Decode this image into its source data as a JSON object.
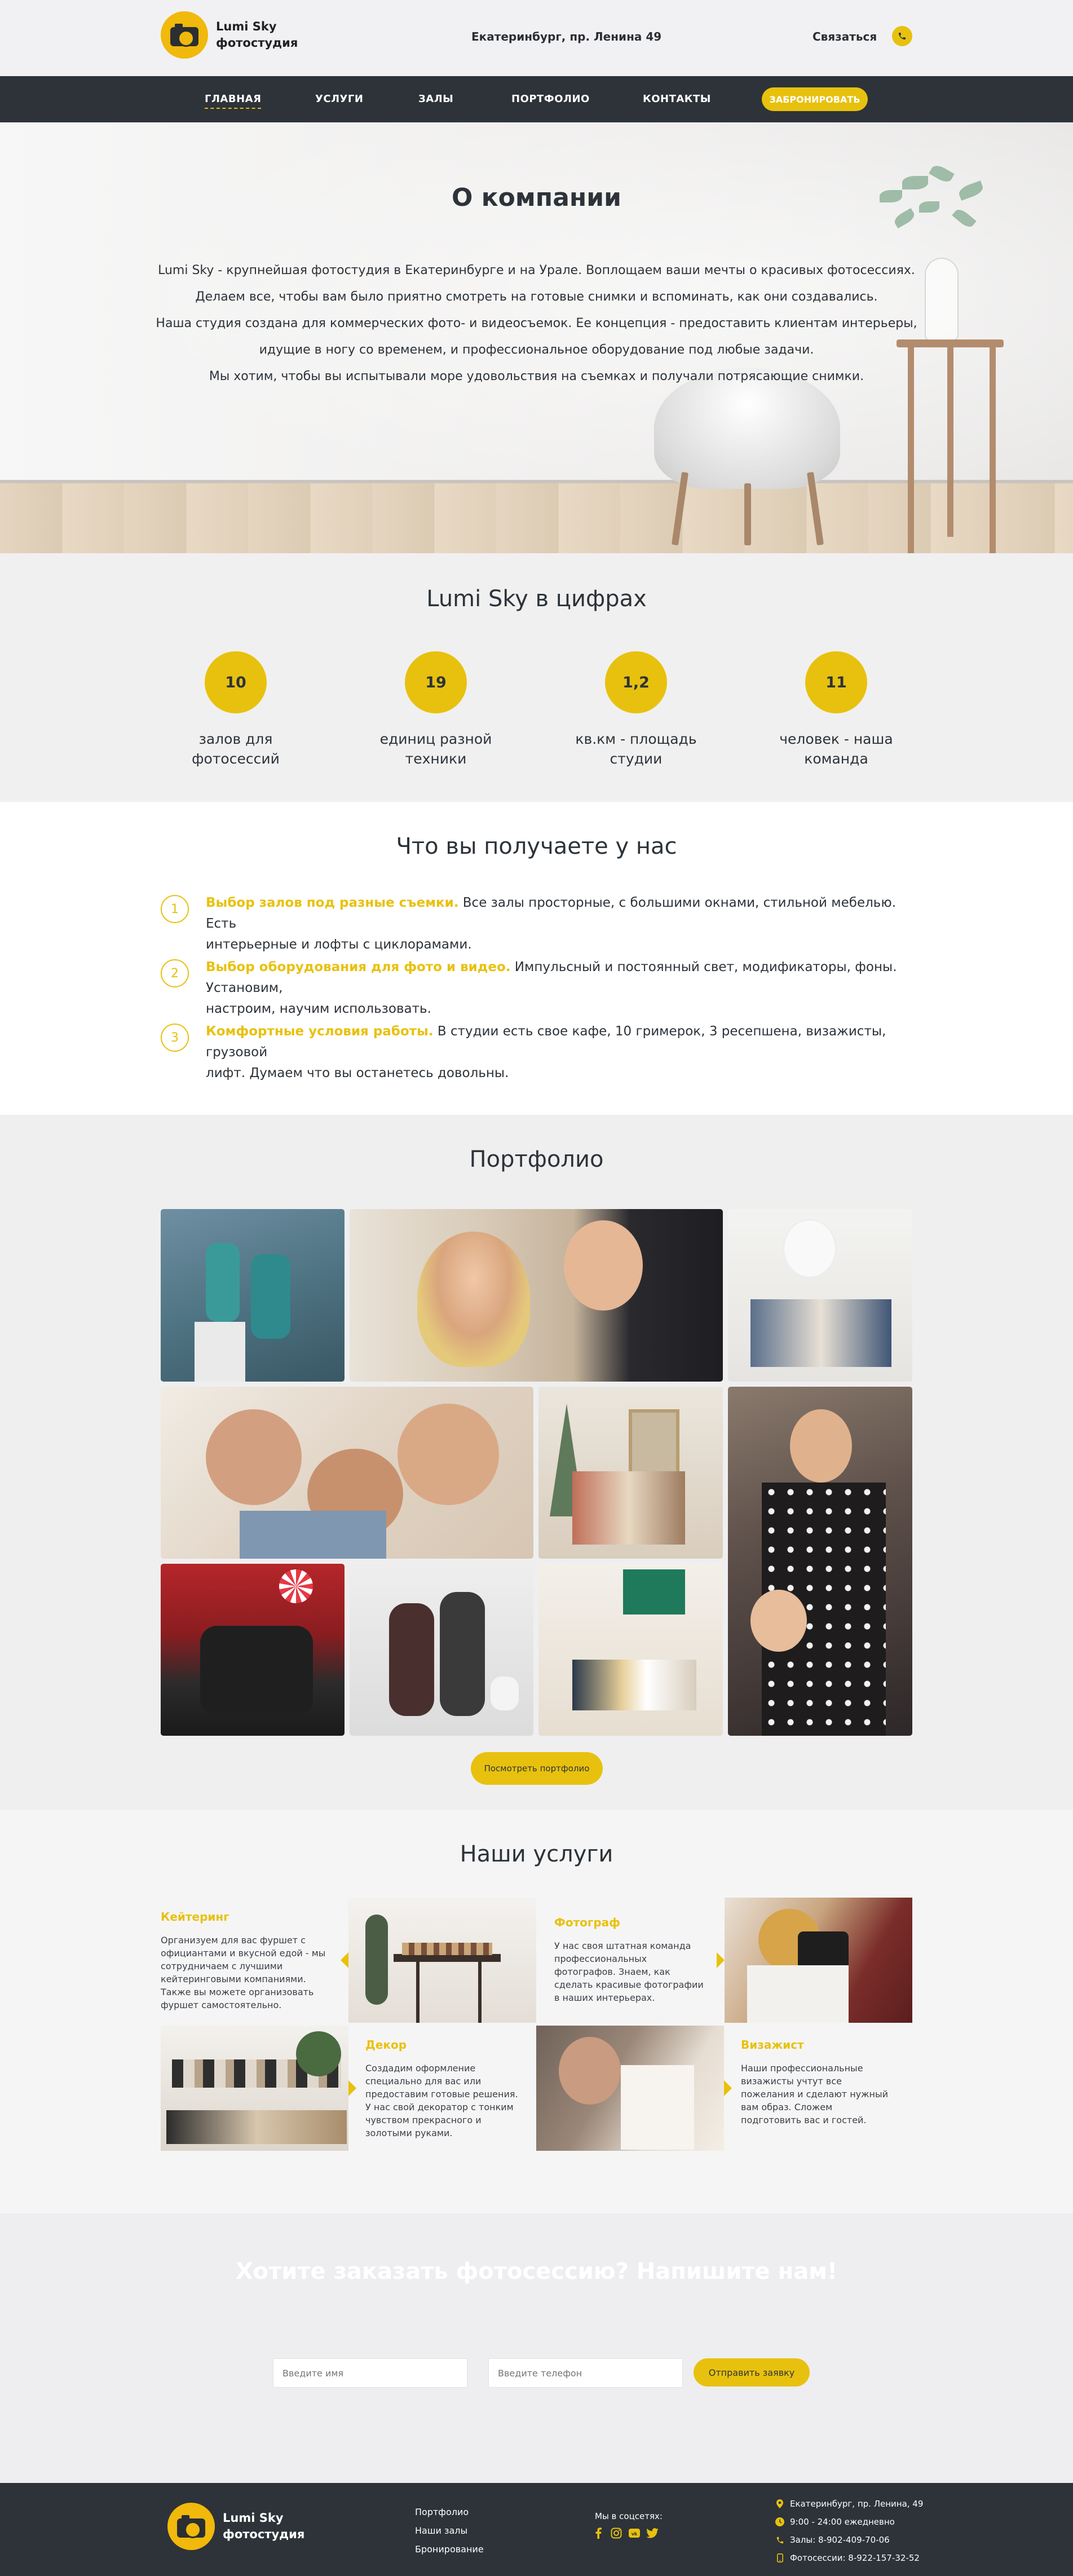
{
  "header": {
    "logo_line1": "Lumi Sky",
    "logo_line2": "фотостудия",
    "address": "Екатеринбург, пр. Ленина 49",
    "contact_label": "Связаться",
    "icons": {
      "phone": "phone-icon"
    }
  },
  "nav": {
    "items": [
      {
        "label": "Главная",
        "active": true
      },
      {
        "label": "Услуги"
      },
      {
        "label": "Залы"
      },
      {
        "label": "Портфолио"
      },
      {
        "label": "Контакты"
      }
    ],
    "book_label": "Забронировать"
  },
  "hero": {
    "title": "О компании",
    "lines": [
      "Lumi Sky - крупнейшая фотостудия в Екатеринбурге и на Урале. Воплощаем ваши мечты о красивых фотосессиях.",
      "Делаем все, чтобы вам было приятно смотреть на готовые снимки и вспоминать, как они создавались.",
      "Наша студия создана для коммерческих фото- и видеосъемок. Ее концепция - предоставить клиентам интерьеры,",
      "идущие в ногу со временем, и профессиональное оборудование под любые задачи.",
      "Мы хотим, чтобы вы испытывали море удовольствия на съемках и получали потрясающие снимки."
    ]
  },
  "numbers": {
    "title": "Lumi Sky в цифрах",
    "stats": [
      {
        "value": "10",
        "label_1": "залов для",
        "label_2": "фотосессий"
      },
      {
        "value": "19",
        "label_1": "единиц разной",
        "label_2": "техники"
      },
      {
        "value": "1,2",
        "label_1": "кв.км - площадь",
        "label_2": "студии"
      },
      {
        "value": "11",
        "label_1": "человек - наша",
        "label_2": "команда"
      }
    ]
  },
  "benefits": {
    "title": "Что вы получаете у нас",
    "items": [
      {
        "num": "1",
        "highlight": "Выбор залов под разные съемки.",
        "line1_rest": " Все залы просторные, с большими окнами, стильной мебелью. Есть",
        "line2": "интерьерные и лофты с циклорамами."
      },
      {
        "num": "2",
        "highlight": "Выбор оборудования для фото и видео.",
        "line1_rest": " Импульсный и постоянный свет, модификаторы, фоны. Установим,",
        "line2": "настроим, научим использовать."
      },
      {
        "num": "3",
        "highlight": "Комфортные условия работы.",
        "line1_rest": " В студии есть свое кафе, 10 гримерок, 3 ресепшена, визажисты, грузовой",
        "line2": "лифт. Думаем что вы останетесь довольны."
      }
    ]
  },
  "portfolio": {
    "title": "Портфолио",
    "button_label": "Посмотреть портфолио"
  },
  "services": {
    "title": "Наши услуги",
    "items": [
      {
        "title": "Кейтеринг",
        "desc": [
          "Организуем для вас фуршет с",
          "официантами и вкусной едой - мы",
          "сотрудничаем с лучшими",
          "кейтеринговыми компаниями.",
          "Также вы можете организовать",
          "фуршет самостоятельно."
        ]
      },
      {
        "title": "Фотограф",
        "desc": [
          "У нас своя штатная команда",
          "профессиональных",
          "фотографов. Знаем, как",
          "сделать красивые фотографии",
          "в наших интерьерах."
        ]
      },
      {
        "title": "Декор",
        "desc": [
          "Создадим оформление",
          "специально для вас или",
          "предоставим готовые решения.",
          "У нас свой декоратор с тонким",
          "чувством прекрасного и",
          "золотыми руками."
        ]
      },
      {
        "title": "Визажист",
        "desc": [
          "Наши профессиональные",
          "визажисты учтут все",
          "пожелания и сделают нужный",
          "вам образ. Сложем",
          "подготовить вас и гостей."
        ]
      }
    ]
  },
  "cta": {
    "title": "Хотите заказать фотосессию? Напишите нам!",
    "name_placeholder": "Введите имя",
    "phone_placeholder": "Введите телефон",
    "button_label": "Отправить заявку"
  },
  "footer": {
    "logo_line1": "Lumi Sky",
    "logo_line2": "фотостудия",
    "links": [
      "Портфолио",
      "Наши залы",
      "Бронирование"
    ],
    "social_label": "Мы в соцсетях:",
    "social_icons": [
      "facebook-icon",
      "instagram-icon",
      "vk-icon",
      "twitter-icon"
    ],
    "contacts": [
      {
        "icon": "location-icon",
        "text": "Екатеринбург, пр. Ленина, 49"
      },
      {
        "icon": "clock-icon",
        "text": "9:00 - 24:00 ежедневно"
      },
      {
        "icon": "phone-icon",
        "text": "Залы: 8-902-409-70-06"
      },
      {
        "icon": "mobile-icon",
        "text": "Фотосессии: 8-922-157-32-52"
      }
    ]
  },
  "colors": {
    "accent": "#e8c10e",
    "dark": "#2d3339"
  }
}
